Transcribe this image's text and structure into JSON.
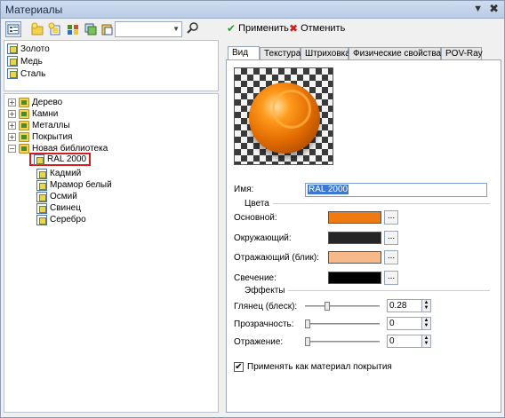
{
  "window": {
    "title": "Материалы",
    "pin_icon": "pin-icon",
    "close_icon": "close-icon"
  },
  "left_toolbar": {
    "buttons": [
      "view-toggle-icon",
      "new-folder-icon",
      "add-material-icon",
      "library-icon",
      "copy-icon",
      "paste-icon"
    ],
    "search_value": "",
    "search_button": "search-icon"
  },
  "top_list": {
    "items": [
      "Золото",
      "Медь",
      "Сталь"
    ]
  },
  "tree": {
    "folders": [
      {
        "label": "Дерево",
        "expanded": false
      },
      {
        "label": "Камни",
        "expanded": false
      },
      {
        "label": "Металлы",
        "expanded": false
      },
      {
        "label": "Покрытия",
        "expanded": false
      },
      {
        "label": "Новая библиотека",
        "expanded": true
      }
    ],
    "children": [
      "RAL 2000",
      "Кадмий",
      "Мрамор белый",
      "Осмий",
      "Свинец",
      "Серебро"
    ],
    "selected": "RAL 2000"
  },
  "right_toolbar": {
    "apply": "Применить",
    "cancel": "Отменить"
  },
  "tabs": [
    "Вид",
    "Текстура",
    "Штриховка",
    "Физические свойства",
    "POV-Ray"
  ],
  "view": {
    "name_label": "Имя:",
    "name_value": "RAL 2000",
    "colors_group": "Цвета",
    "colors": [
      {
        "label": "Основной:",
        "color": "#f07a12"
      },
      {
        "label": "Окружающий:",
        "color": "#262626"
      },
      {
        "label": "Отражающий (блик):",
        "color": "#f7b987"
      },
      {
        "label": "Свечение:",
        "color": "#000000"
      }
    ],
    "more_button": "...",
    "effects_group": "Эффекты",
    "effects": [
      {
        "label": "Глянец (блеск):",
        "value": "0.28",
        "level": 0.28
      },
      {
        "label": "Прозрачность:",
        "value": "0",
        "level": 0
      },
      {
        "label": "Отражение:",
        "value": "0",
        "level": 0
      }
    ],
    "apply_as_coating": "Применять как материал покрытия",
    "apply_as_coating_checked": true
  }
}
